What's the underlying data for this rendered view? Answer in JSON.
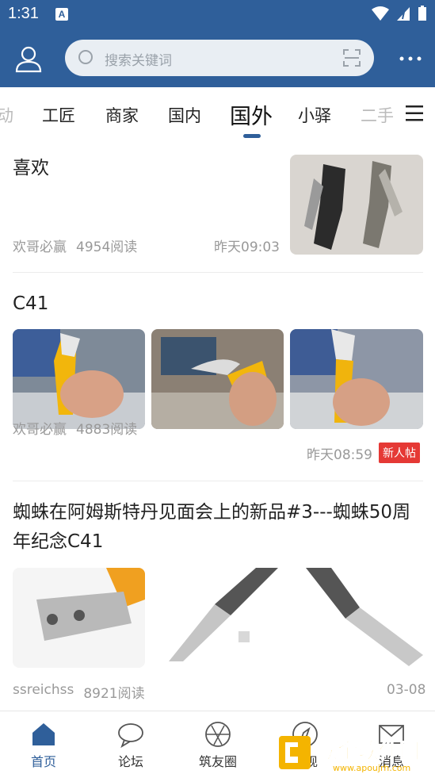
{
  "status": {
    "time": "1:31",
    "app_badge": "A"
  },
  "search": {
    "placeholder": "搜索关键词"
  },
  "tabs": {
    "items": [
      {
        "label": "动",
        "faded": true
      },
      {
        "label": "工匠"
      },
      {
        "label": "商家"
      },
      {
        "label": "国内"
      },
      {
        "label": "国外",
        "active": true
      },
      {
        "label": "小驿"
      },
      {
        "label": "二手",
        "faded": true
      }
    ]
  },
  "articles": [
    {
      "title": "喜欢",
      "author": "欢哥必赢",
      "reads": "4954阅读",
      "time": "昨天09:03"
    },
    {
      "title": "C41",
      "author": "欢哥必赢",
      "reads": "4883阅读",
      "time": "昨天08:59",
      "badge": "新人帖"
    },
    {
      "title_line1": "蜘蛛在阿姆斯特丹见面会上的新品#3---蜘蛛50周",
      "title_line2": "年纪念C41",
      "author": "ssreichss",
      "reads": "8921阅读",
      "time": "03-08"
    }
  ],
  "bottom_nav": {
    "home": "首页",
    "forum": "论坛",
    "circle": "筑友圈",
    "discover": "发现",
    "message": "消息"
  },
  "watermark": {
    "text": "欧金软件园",
    "url": "www.apoujrh.com"
  },
  "colors": {
    "brand": "#2f5f9a",
    "badge": "#e53935"
  }
}
